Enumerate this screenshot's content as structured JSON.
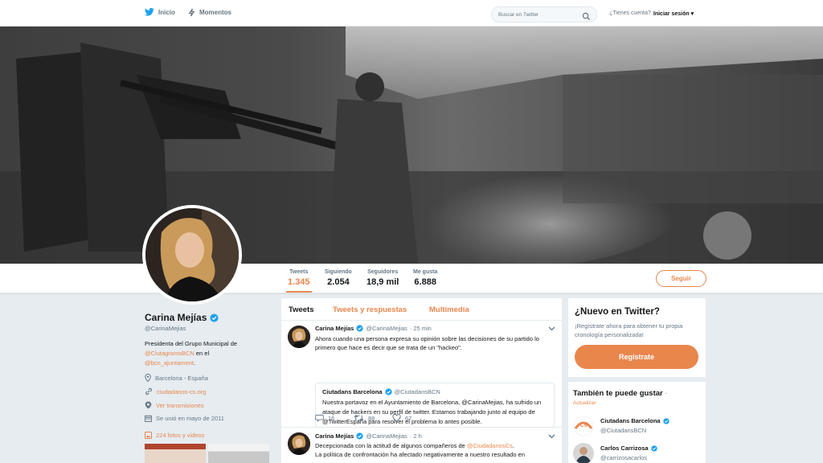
{
  "topnav": {
    "home_label": "Inicio",
    "moments_label": "Momentos",
    "search_placeholder": "Buscar en Twitter",
    "have_account": "¿Tienes cuenta?",
    "login_label": "Iniciar sesión"
  },
  "profile": {
    "name": "Carina Mejías",
    "handle": "@CarinaMejias",
    "bio_text1": "Presidenta del Grupo Municipal de",
    "bio_mention1": "@CiutagramsBCN",
    "bio_text2": " en el",
    "bio_mention2": "@bcn_ajuntament",
    "bio_text3": ".",
    "location": "Barcelona - España",
    "website": "ciudadanos-cs.org",
    "periscope": "Ver transmisiones",
    "joined": "Se unió en mayo de 2011",
    "photos_label": "224 fotos y videos"
  },
  "stats": [
    {
      "label": "Tweets",
      "value": "1.345"
    },
    {
      "label": "Siguiendo",
      "value": "2.054"
    },
    {
      "label": "Seguidores",
      "value": "18,9 mil"
    },
    {
      "label": "Me gusta",
      "value": "6.888"
    }
  ],
  "follow_label": "Seguir",
  "tabs": {
    "tweets": "Tweets",
    "replies": "Tweets y respuestas",
    "media": "Multimedia"
  },
  "tweet1": {
    "name": "Carina Mejías",
    "handle": "@CarinaMejias",
    "time": "· 25 min",
    "text": "Ahora cuando una persona expresa su opinión sobre las decisiones de su partido lo primero que hace es decir que se trata de un \"hackeo\".",
    "quote_name": "Ciutadans Barcelona",
    "quote_handle": "@CiutadansBCN",
    "quote_text": "Nuestra portavoz en el Ayuntamiento de Barcelona, @CarinaMejias, ha sufrido un ataque de hackers en su perfil de twitter. Estamos trabajando junto al equipo de @TwitterEspana para resolver el problema lo antes posible.",
    "replies": "16",
    "retweets": "88",
    "likes": "67"
  },
  "tweet2": {
    "name": "Carina Mejías",
    "handle": "@CarinaMejias",
    "time": "· 2 h",
    "text_prefix": "Decepcionada con la actitud de algunos compañeros de ",
    "text_mention": "@CiudadanosCs",
    "text_suffix": ".",
    "text_line2": "La política de confrontación ha afectado negativamente a nuestro resultado en"
  },
  "newcard": {
    "title": "¿Nuevo en Twitter?",
    "desc": "¡Regístrate ahora para obtener tu propia cronología personalizada!",
    "button": "Regístrate"
  },
  "suggestions": {
    "title": "También te puede gustar",
    "dot": " ·",
    "update": "Actualizar",
    "items": [
      {
        "name": "Ciutadans Barcelona",
        "handle": "@CiutadansBCN",
        "badge": "Cs"
      },
      {
        "name": "Carlos Carrizosa",
        "handle": "@carrizosacarlos"
      }
    ]
  },
  "colors": {
    "accent": "#e9864c",
    "verified": "#1da1f2",
    "twitter_blue": "#1da1f2"
  }
}
